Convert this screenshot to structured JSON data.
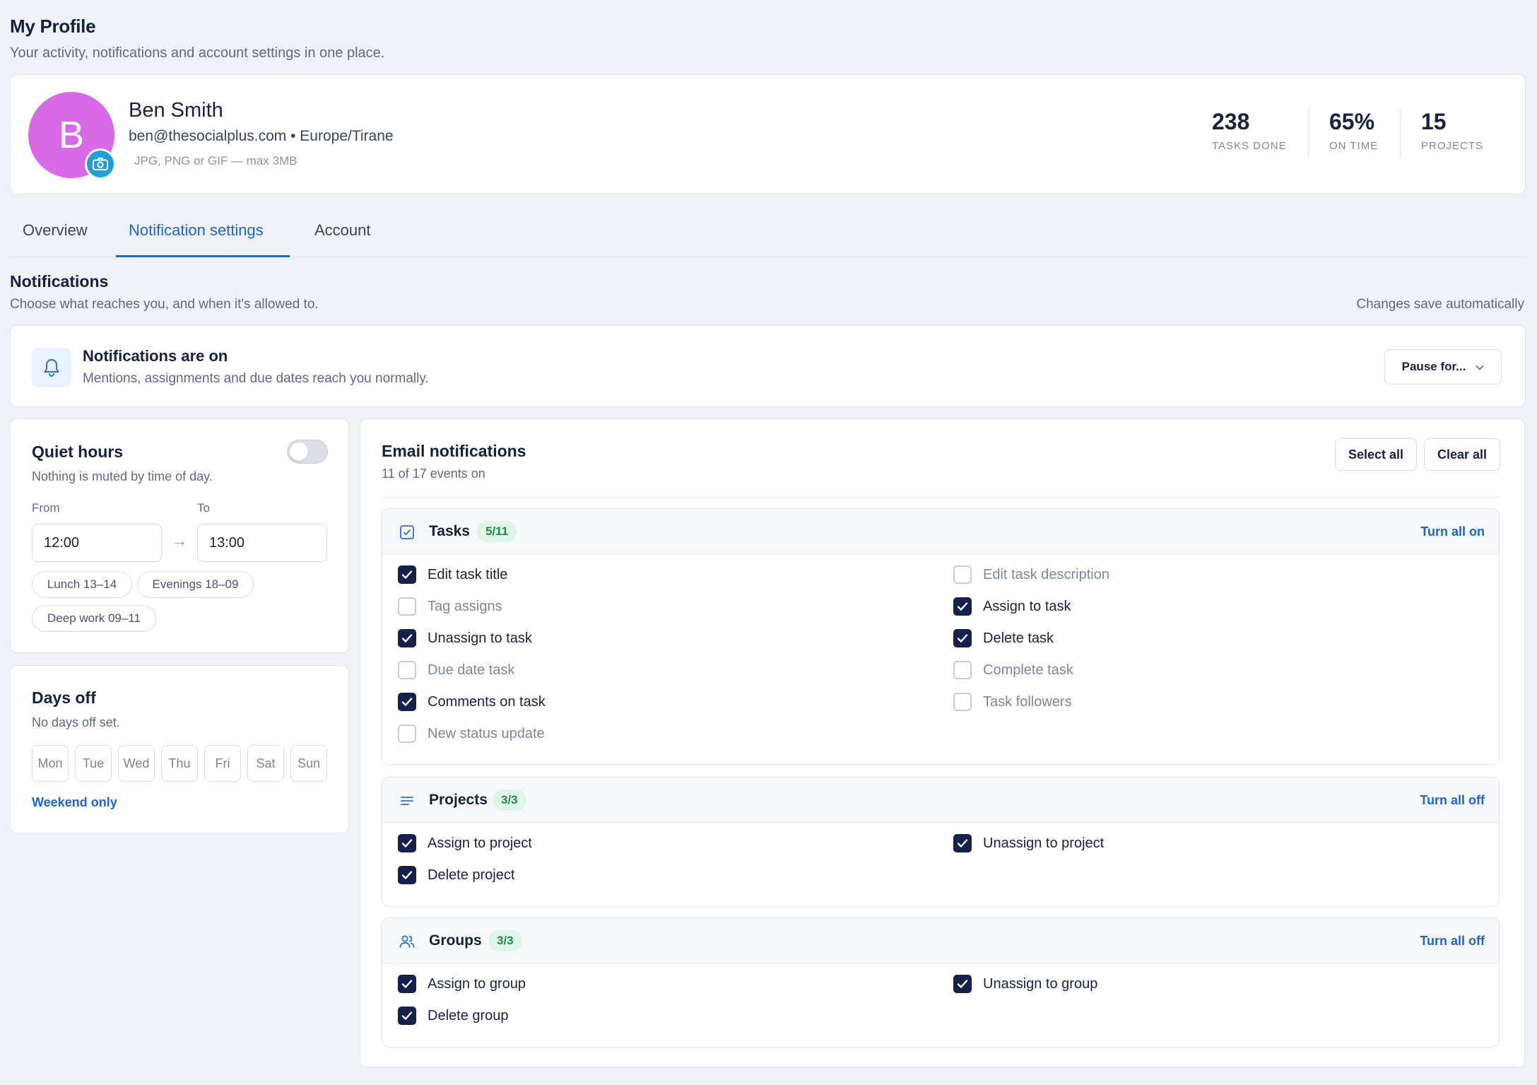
{
  "header": {
    "title": "My Profile",
    "subtitle": "Your activity, notifications and account settings in one place."
  },
  "profile": {
    "initial": "B",
    "name": "Ben Smith",
    "email_line": "ben@thesocialplus.com • Europe/Tirane",
    "upload_hint": "JPG, PNG or GIF — max 3MB",
    "avatar_color": "#d86ae8",
    "stats": [
      {
        "value": "238",
        "label": "TASKS DONE"
      },
      {
        "value": "65%",
        "label": "ON TIME"
      },
      {
        "value": "15",
        "label": "PROJECTS"
      }
    ]
  },
  "tabs": [
    {
      "label": "Overview",
      "active": false
    },
    {
      "label": "Notification settings",
      "active": true
    },
    {
      "label": "Account",
      "active": false
    }
  ],
  "notifications": {
    "title": "Notifications",
    "subtitle": "Choose what reaches you, and when it's allowed to.",
    "autosave": "Changes save automatically",
    "status_title": "Notifications are on",
    "status_sub": "Mentions, assignments and due dates reach you normally.",
    "pause_label": "Pause for..."
  },
  "quiet_hours": {
    "title": "Quiet hours",
    "subtitle": "Nothing is muted by time of day.",
    "enabled": false,
    "from_label": "From",
    "to_label": "To",
    "from_value": "12:00",
    "to_value": "13:00",
    "arrow": "→",
    "presets": [
      "Lunch 13–14",
      "Evenings 18–09",
      "Deep work 09–11"
    ]
  },
  "days_off": {
    "title": "Days off",
    "subtitle": "No days off set.",
    "days": [
      "Mon",
      "Tue",
      "Wed",
      "Thu",
      "Fri",
      "Sat",
      "Sun"
    ],
    "weekend_link": "Weekend only"
  },
  "email": {
    "title": "Email notifications",
    "subtitle": "11 of 17 events on",
    "select_all": "Select all",
    "clear_all": "Clear all",
    "groups": [
      {
        "title": "Tasks",
        "badge": "5/11",
        "action": "Turn all on",
        "icon": "checkbox-square-icon",
        "items": [
          {
            "label": "Edit task title",
            "checked": true
          },
          {
            "label": "Edit task description",
            "checked": false
          },
          {
            "label": "Tag assigns",
            "checked": false
          },
          {
            "label": "Assign to task",
            "checked": true
          },
          {
            "label": "Unassign to task",
            "checked": true
          },
          {
            "label": "Delete task",
            "checked": true
          },
          {
            "label": "Due date task",
            "checked": false
          },
          {
            "label": "Complete task",
            "checked": false
          },
          {
            "label": "Comments on task",
            "checked": true
          },
          {
            "label": "Task followers",
            "checked": false
          },
          {
            "label": "New status update",
            "checked": false
          }
        ]
      },
      {
        "title": "Projects",
        "badge": "3/3",
        "action": "Turn all off",
        "icon": "list-lines-icon",
        "items": [
          {
            "label": "Assign to project",
            "checked": true
          },
          {
            "label": "Unassign to project",
            "checked": true
          },
          {
            "label": "Delete project",
            "checked": true
          }
        ]
      },
      {
        "title": "Groups",
        "badge": "3/3",
        "action": "Turn all off",
        "icon": "users-icon",
        "items": [
          {
            "label": "Assign to group",
            "checked": true
          },
          {
            "label": "Unassign to group",
            "checked": true
          },
          {
            "label": "Delete group",
            "checked": true
          }
        ]
      }
    ]
  },
  "colors": {
    "accent": "#1e64d6",
    "checkbox_on": "#15214a",
    "badge_bg": "#dff5e7",
    "badge_text": "#1f8a4c"
  }
}
